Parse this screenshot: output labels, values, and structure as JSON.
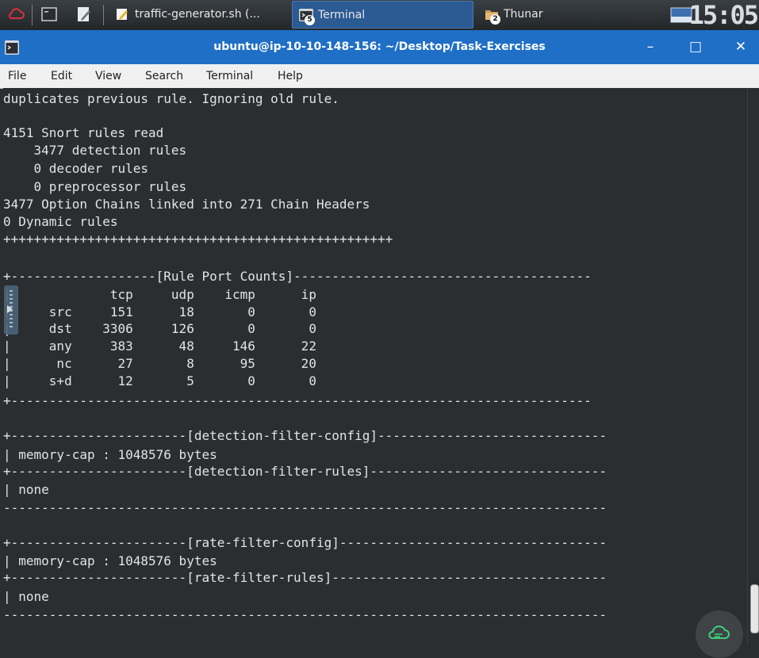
{
  "panel": {
    "tasks": [
      {
        "label": "traffic-generator.sh (...",
        "icon": "text-editor-icon"
      },
      {
        "label": "Terminal",
        "icon": "terminal-icon",
        "badge": "5"
      },
      {
        "label": "Thunar",
        "icon": "folder-icon",
        "badge": "2"
      }
    ],
    "clock": "15:05"
  },
  "window": {
    "title": "ubuntu@ip-10-10-148-156: ~/Desktop/Task-Exercises",
    "minimize": "–",
    "maximize": "□",
    "close": "✕"
  },
  "menu": [
    "File",
    "Edit",
    "View",
    "Search",
    "Terminal",
    "Help"
  ],
  "terminal_lines": [
    "duplicates previous rule. Ignoring old rule.",
    "",
    "4151 Snort rules read",
    "    3477 detection rules",
    "    0 decoder rules",
    "    0 preprocessor rules",
    "3477 Option Chains linked into 271 Chain Headers",
    "0 Dynamic rules",
    "+++++++++++++++++++++++++++++++++++++++++++++++++++",
    "",
    "+-------------------[Rule Port Counts]---------------------------------------",
    "|             tcp     udp    icmp      ip",
    "|     src     151      18       0       0",
    "|     dst    3306     126       0       0",
    "|     any     383      48     146      22",
    "|      nc      27       8      95      20",
    "|     s+d      12       5       0       0",
    "+----------------------------------------------------------------------------",
    "",
    "+-----------------------[detection-filter-config]------------------------------",
    "| memory-cap : 1048576 bytes",
    "+-----------------------[detection-filter-rules]-------------------------------",
    "| none",
    "-------------------------------------------------------------------------------",
    "",
    "+-----------------------[rate-filter-config]-----------------------------------",
    "| memory-cap : 1048576 bytes",
    "+-----------------------[rate-filter-rules]------------------------------------",
    "| none",
    "-------------------------------------------------------------------------------"
  ],
  "colors": {
    "titlebar": "#1f6fc6",
    "terminal_bg": "#2b2e30",
    "terminal_fg": "#e3e3e3",
    "active_task": "#2c5a93"
  }
}
